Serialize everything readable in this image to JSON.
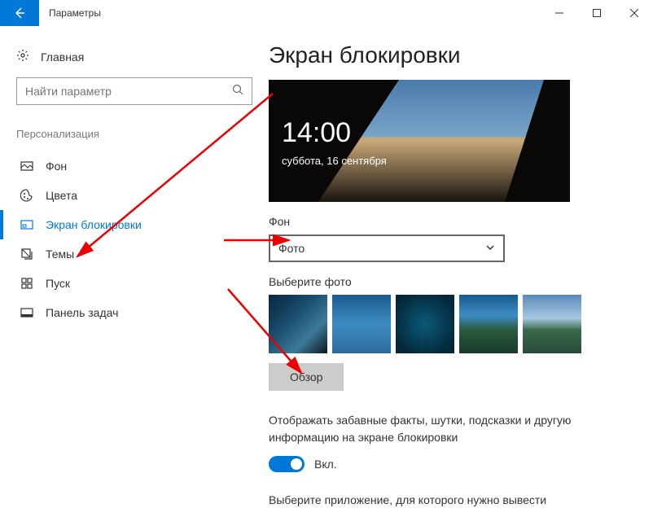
{
  "titlebar": {
    "title": "Параметры"
  },
  "sidebar": {
    "home": "Главная",
    "search_placeholder": "Найти параметр",
    "section": "Персонализация",
    "items": [
      {
        "label": "Фон"
      },
      {
        "label": "Цвета"
      },
      {
        "label": "Экран блокировки"
      },
      {
        "label": "Темы"
      },
      {
        "label": "Пуск"
      },
      {
        "label": "Панель задач"
      }
    ]
  },
  "main": {
    "heading": "Экран блокировки",
    "preview": {
      "time": "14:00",
      "date": "суббота, 16 сентября"
    },
    "bg_label": "Фон",
    "bg_value": "Фото",
    "choose_label": "Выберите фото",
    "browse_label": "Обзор",
    "facts_text": "Отображать забавные факты, шутки, подсказки и другую информацию на экране блокировки",
    "toggle_label": "Вкл.",
    "footer_text": "Выберите приложение, для которого нужно вывести"
  }
}
